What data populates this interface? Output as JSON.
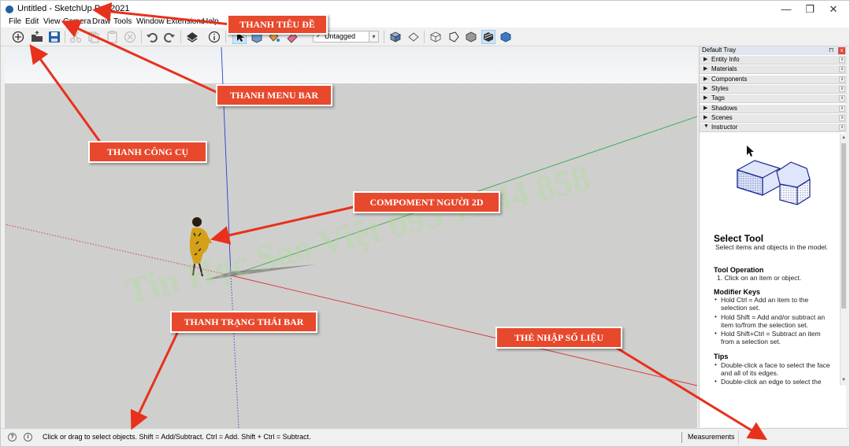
{
  "window": {
    "title": "Untitled - SketchUp Pro 2021",
    "controls": {
      "minimize": "—",
      "maximize": "❐",
      "close": "✕"
    }
  },
  "menu": [
    {
      "label": "File"
    },
    {
      "label": "Edit"
    },
    {
      "label": "View"
    },
    {
      "label": "Camera"
    },
    {
      "label": "Draw"
    },
    {
      "label": "Tools"
    },
    {
      "label": "Window"
    },
    {
      "label": "Extensions"
    },
    {
      "label": "Help"
    }
  ],
  "toolbar": {
    "tag_selector": {
      "check": "✓",
      "value": "Untagged",
      "arrow": "▾"
    }
  },
  "tray": {
    "title": "Default Tray",
    "pin": "📌",
    "close": "x",
    "panels": [
      {
        "label": "Entity Info",
        "expanded": false
      },
      {
        "label": "Materials",
        "expanded": false
      },
      {
        "label": "Components",
        "expanded": false
      },
      {
        "label": "Styles",
        "expanded": false
      },
      {
        "label": "Tags",
        "expanded": false
      },
      {
        "label": "Shadows",
        "expanded": false
      },
      {
        "label": "Scenes",
        "expanded": false
      },
      {
        "label": "Instructor",
        "expanded": true
      }
    ],
    "triangle_collapsed": "▶",
    "triangle_expanded": "▼",
    "panel_close": "x"
  },
  "instructor": {
    "title": "Select Tool",
    "description": "Select items and objects in the model.",
    "sections": [
      {
        "heading": "Tool Operation",
        "items": [
          "1. Click on an item or object."
        ]
      },
      {
        "heading": "Modifier Keys",
        "items": [
          "Hold Ctrl = Add an item to the selection set.",
          "Hold Shift = Add and/or subtract an item to/from the selection set.",
          "Hold Shift+Ctrl = Subtract an item from a selection set."
        ]
      },
      {
        "heading": "Tips",
        "items": [
          "Double-click a face to select the face and all of its edges.",
          "Double-click an edge to select the"
        ]
      }
    ]
  },
  "statusbar": {
    "text": "Click or drag to select objects. Shift = Add/Subtract. Ctrl = Add. Shift + Ctrl = Subtract.",
    "icon_geo": "?",
    "icon_info": "i",
    "measurements_label": "Measurements"
  },
  "annotations": {
    "title_bar": "THANH TIÊU ĐỀ",
    "menu_bar": "THANH MENU BAR",
    "toolbar": "THANH CÔNG CỤ",
    "component": "COMPOMENT NGƯỜI 2D",
    "status_bar": "THANH TRẠNG THÁI BAR",
    "measurements": "THẺ NHẬP SỐ LIỆU"
  },
  "watermark": "Tin Học Sao Việt 093 11 44 858",
  "colors": {
    "callout": "#e8492c",
    "axis_red": "#d8363a",
    "axis_green": "#3aa84a",
    "axis_blue": "#2b3fd0",
    "sky": "#eef1f4",
    "ground": "#cfcfcd"
  }
}
